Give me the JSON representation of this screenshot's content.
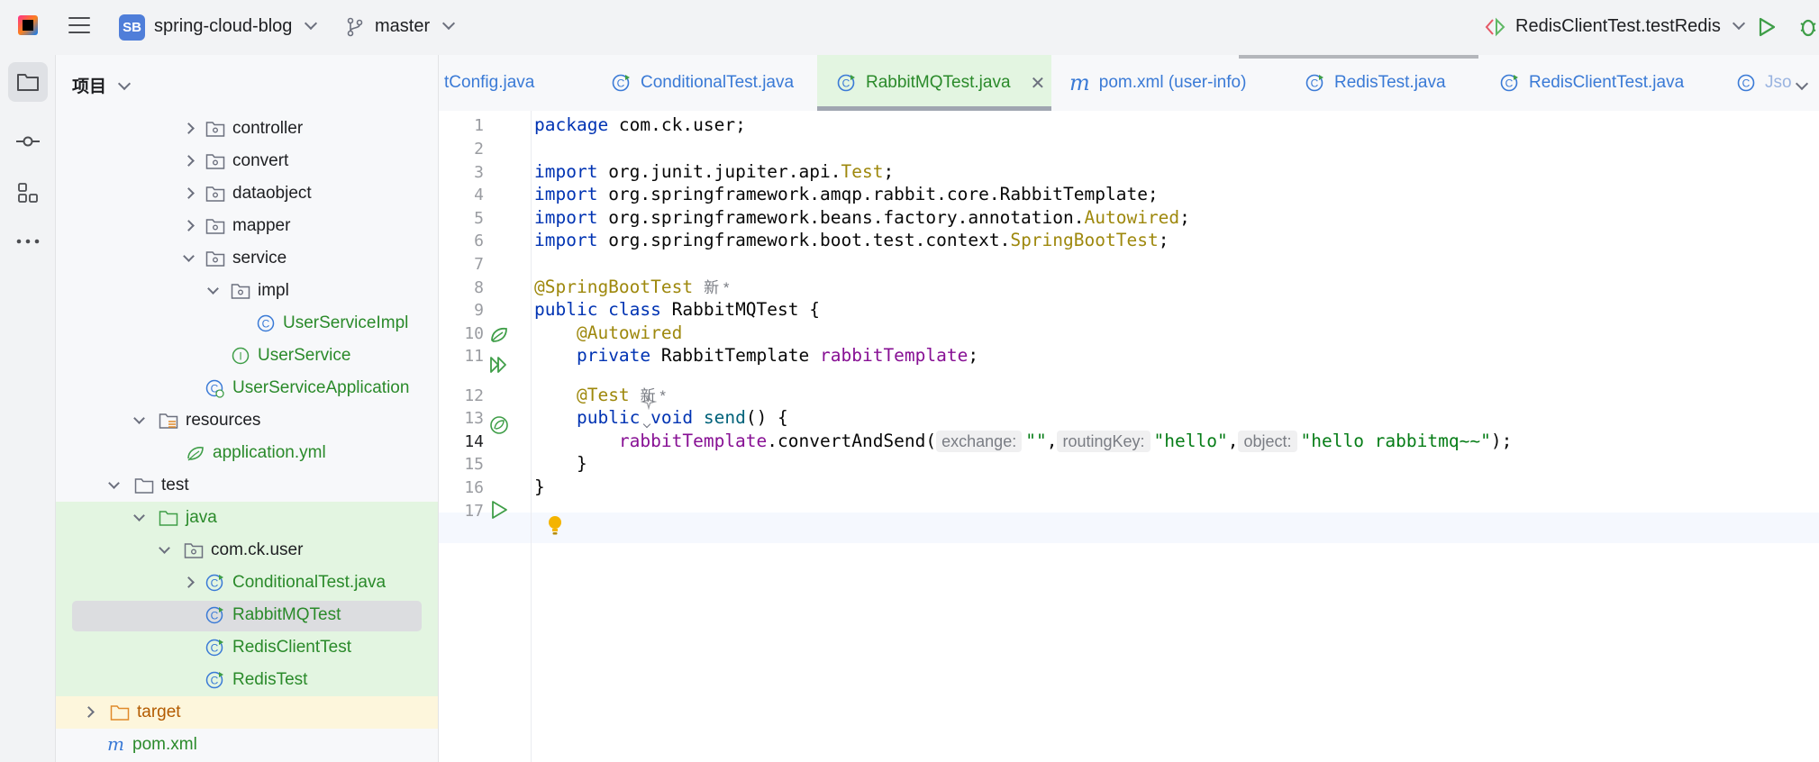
{
  "topbar": {
    "project_badge": "SB",
    "project_name": "spring-cloud-blog",
    "branch": "master",
    "run_config": "RedisClientTest.testRedis"
  },
  "project_panel": {
    "title": "项目",
    "tree": [
      {
        "label": "controller",
        "type": "package",
        "arrow": "right"
      },
      {
        "label": "convert",
        "type": "package",
        "arrow": "right"
      },
      {
        "label": "dataobject",
        "type": "package",
        "arrow": "right"
      },
      {
        "label": "mapper",
        "type": "package",
        "arrow": "right"
      },
      {
        "label": "service",
        "type": "package",
        "arrow": "down"
      },
      {
        "label": "impl",
        "type": "package",
        "arrow": "down"
      },
      {
        "label": "UserServiceImpl",
        "type": "class"
      },
      {
        "label": "UserService",
        "type": "interface"
      },
      {
        "label": "UserServiceApplication",
        "type": "springapp"
      },
      {
        "label": "resources",
        "type": "resources",
        "arrow": "down"
      },
      {
        "label": "application.yml",
        "type": "yml"
      },
      {
        "label": "test",
        "type": "folder",
        "arrow": "down"
      },
      {
        "label": "java",
        "type": "testfolder",
        "arrow": "down"
      },
      {
        "label": "com.ck.user",
        "type": "package",
        "arrow": "down"
      },
      {
        "label": "ConditionalTest.java",
        "type": "testclass",
        "arrow": "right"
      },
      {
        "label": "RabbitMQTest",
        "type": "testclass"
      },
      {
        "label": "RedisClientTest",
        "type": "testclass"
      },
      {
        "label": "RedisTest",
        "type": "testclass"
      },
      {
        "label": "target",
        "type": "excluded",
        "arrow": "right"
      },
      {
        "label": "pom.xml",
        "type": "maven"
      }
    ]
  },
  "tabs": [
    {
      "label": "tConfig.java",
      "icon": "none"
    },
    {
      "label": "ConditionalTest.java",
      "icon": "class-icon"
    },
    {
      "label": "RabbitMQTest.java",
      "icon": "class-icon",
      "active": true
    },
    {
      "label": "pom.xml (user-info)",
      "icon": "maven-icon"
    },
    {
      "label": "RedisTest.java",
      "icon": "class-icon"
    },
    {
      "label": "RedisClientTest.java",
      "icon": "class-icon"
    },
    {
      "label": "Jso",
      "icon": "class-icon"
    }
  ],
  "editor": {
    "line_numbers": [
      "1",
      "2",
      "3",
      "4",
      "5",
      "6",
      "7",
      "8",
      "9",
      "10",
      "11",
      "12",
      "13",
      "14",
      "15",
      "16",
      "17"
    ],
    "new_badge": "新 *",
    "code": {
      "l1_kw": "package",
      "l1_rest": " com.ck.user;",
      "l3_kw": "import",
      "l3_pkg": " org.junit.jupiter.api.",
      "l3_cls": "Test",
      "l3_end": ";",
      "l4_kw": "import",
      "l4_rest": " org.springframework.amqp.rabbit.core.RabbitTemplate;",
      "l5_kw": "import",
      "l5_pkg": " org.springframework.beans.factory.annotation.",
      "l5_cls": "Autowired",
      "l5_end": ";",
      "l6_kw": "import",
      "l6_pkg": " org.springframework.boot.test.context.",
      "l6_cls": "SpringBootTest",
      "l6_end": ";",
      "l8_ann": "@SpringBootTest",
      "l9_kw": "public class",
      "l9_rest": " RabbitMQTest {",
      "l10_ann": "@Autowired",
      "l11_kw": "private",
      "l11_type": " RabbitTemplate ",
      "l11_fld": "rabbitTemplate",
      "l11_end": ";",
      "l12_ann": "@Test",
      "l13_kw": "public void",
      "l13_mth": "send",
      "l13_end": "() {",
      "l14_fld": "rabbitTemplate",
      "l14_call": ".convertAndSend(",
      "l14_hint1": "exchange:",
      "l14_arg1": "\"\"",
      "l14_hint2": "routingKey:",
      "l14_arg2": "\"hello\"",
      "l14_hint3": "object:",
      "l14_arg3": "\"hello rabbitmq~~\"",
      "l14_end": ");",
      "l15": "}",
      "l16": "}"
    }
  }
}
